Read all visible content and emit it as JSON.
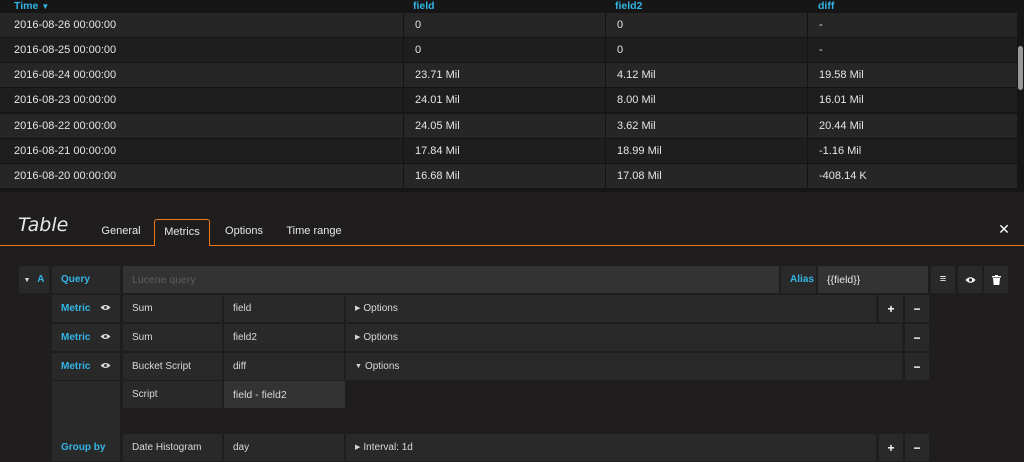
{
  "table": {
    "columns": [
      {
        "label": "Time",
        "sorted": "desc"
      },
      {
        "label": "field"
      },
      {
        "label": "field2"
      },
      {
        "label": "diff"
      }
    ],
    "rows": [
      [
        "2016-08-26 00:00:00",
        "0",
        "0",
        "-"
      ],
      [
        "2016-08-25 00:00:00",
        "0",
        "0",
        "-"
      ],
      [
        "2016-08-24 00:00:00",
        "23.71 Mil",
        "4.12 Mil",
        "19.58 Mil"
      ],
      [
        "2016-08-23 00:00:00",
        "24.01 Mil",
        "8.00 Mil",
        "16.01 Mil"
      ],
      [
        "2016-08-22 00:00:00",
        "24.05 Mil",
        "3.62 Mil",
        "20.44 Mil"
      ],
      [
        "2016-08-21 00:00:00",
        "17.84 Mil",
        "18.99 Mil",
        "-1.16 Mil"
      ],
      [
        "2016-08-20 00:00:00",
        "16.68 Mil",
        "17.08 Mil",
        "-408.14 K"
      ]
    ]
  },
  "editor": {
    "title": "Table",
    "tabs": [
      "General",
      "Metrics",
      "Options",
      "Time range"
    ],
    "active_tab": "Metrics",
    "close_icon": "close-icon"
  },
  "query": {
    "ref_id": "A",
    "query_label": "Query",
    "query_value": "",
    "query_placeholder": "Lucene query",
    "alias_label": "Alias",
    "alias_value": "{{field}}",
    "metrics": [
      {
        "label": "Metric",
        "type": "Sum",
        "field": "field",
        "options": "Options"
      },
      {
        "label": "Metric",
        "type": "Sum",
        "field": "field2",
        "options": "Options"
      },
      {
        "label": "Metric",
        "type": "Bucket Script",
        "field": "diff",
        "options": "Options"
      }
    ],
    "script_label": "Script",
    "script_value": "field - field2",
    "group_by": {
      "label": "Group by",
      "type": "Date Histogram",
      "field": "day",
      "options": "Interval: 1d"
    }
  },
  "colors": {
    "accent_blue": "#33b5e5",
    "tab_orange": "#eb7b18",
    "background": "#1f1d1d"
  }
}
